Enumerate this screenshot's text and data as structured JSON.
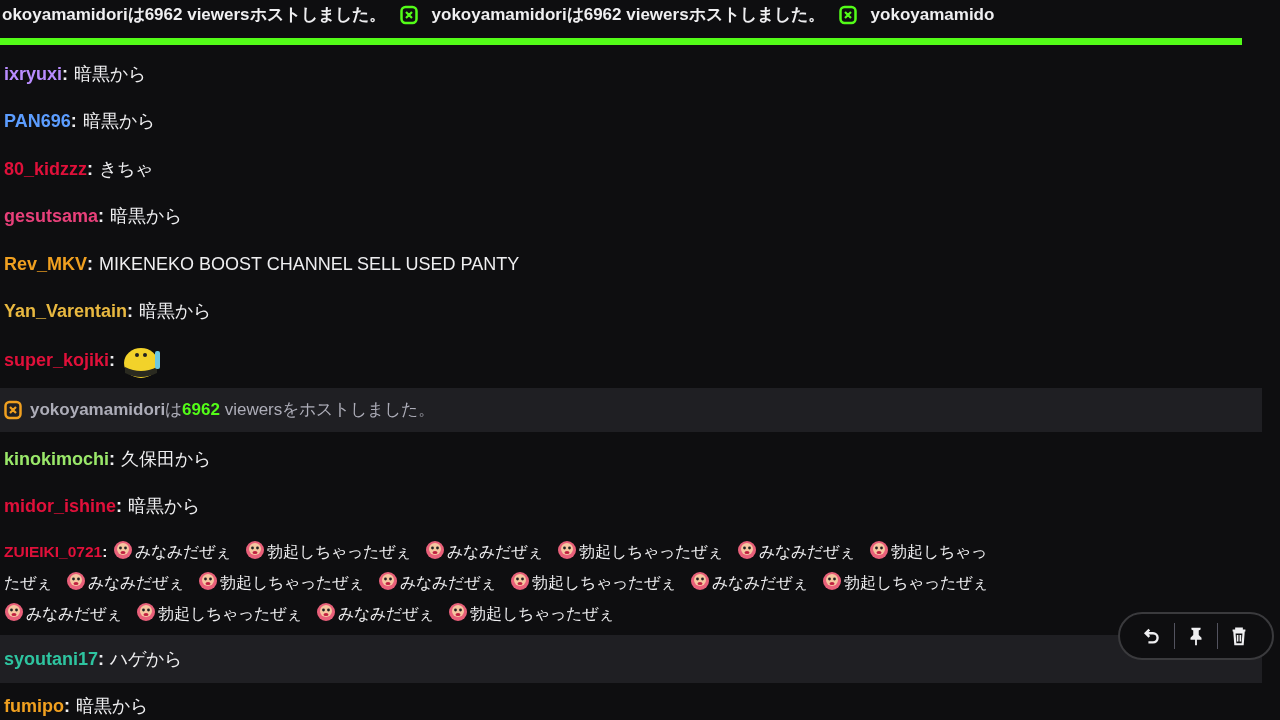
{
  "host_banner": {
    "segments": [
      "okoyamamidoriは6962 viewersホストしました。",
      "yokoyamamidoriは6962 viewersホストしました。",
      "yokoyamamido"
    ],
    "level": 0.97
  },
  "messages": [
    {
      "kind": "text",
      "user": "ixryuxi",
      "sep": ":",
      "color": "#b98cff",
      "text": "暗黒から"
    },
    {
      "kind": "text",
      "user": "PAN696",
      "sep": ":",
      "color": "#5c9dff",
      "text": "暗黒から"
    },
    {
      "kind": "text",
      "user": "80_kidzzz",
      "sep": ":",
      "color": "#e0103a",
      "text": "きちゃ"
    },
    {
      "kind": "text",
      "user": "gesutsama",
      "sep": ":",
      "color": "#e8407a",
      "text": "暗黒から"
    },
    {
      "kind": "text",
      "user": "Rev_MKV",
      "sep": ":",
      "color": "#f0a020",
      "text": "MIKENEKO BOOST CHANNEL SELL USED PANTY"
    },
    {
      "kind": "text",
      "user": "Yan_Varentain",
      "sep": ":",
      "color": "#e8b840",
      "text": "暗黒から"
    },
    {
      "kind": "sticker",
      "user": "super_kojiki",
      "sep": ":",
      "color": "#e0103a"
    },
    {
      "kind": "host",
      "user": "yokoyamamidori",
      "mid": "は",
      "count": "6962",
      "rest": " viewersをホストしました。"
    },
    {
      "kind": "text",
      "user": "kinokimochi",
      "sep": ":",
      "color": "#9ae86a",
      "text": "久保田から"
    },
    {
      "kind": "text",
      "user": "midor_ishine",
      "sep": ":",
      "color": "#e0103a",
      "text": "暗黒から"
    },
    {
      "kind": "emotes",
      "user": "ZUIEIKI_0721",
      "sep": ":",
      "color": "#e0103a",
      "lines": [
        [
          {
            "emote": true,
            "text": "みなみだぜぇ"
          },
          {
            "emote": true,
            "text": "勃起しちゃったぜぇ"
          },
          {
            "emote": true,
            "text": "みなみだぜぇ"
          },
          {
            "emote": true,
            "text": "勃起しちゃったぜぇ"
          },
          {
            "emote": true,
            "text": "みなみだぜぇ"
          },
          {
            "emote": true,
            "text": "勃起しちゃっ"
          }
        ],
        [
          {
            "emote": false,
            "text": "たぜぇ"
          },
          {
            "emote": true,
            "text": "みなみだぜぇ"
          },
          {
            "emote": true,
            "text": "勃起しちゃったぜぇ"
          },
          {
            "emote": true,
            "text": "みなみだぜぇ"
          },
          {
            "emote": true,
            "text": "勃起しちゃったぜぇ"
          },
          {
            "emote": true,
            "text": "みなみだぜぇ"
          },
          {
            "emote": true,
            "text": "勃起しちゃったぜぇ"
          }
        ],
        [
          {
            "emote": true,
            "text": "みなみだぜぇ"
          },
          {
            "emote": true,
            "text": "勃起しちゃったぜぇ"
          },
          {
            "emote": true,
            "text": "みなみだぜぇ"
          },
          {
            "emote": true,
            "text": "勃起しちゃったぜぇ"
          }
        ]
      ]
    },
    {
      "kind": "text",
      "user": "syoutani17",
      "sep": ":",
      "color": "#2ec4a0",
      "text": "ハゲから",
      "hovered": true
    },
    {
      "kind": "text",
      "user": "fumipo",
      "sep": ":",
      "color": "#f0a020",
      "text": "暗黒から"
    }
  ]
}
